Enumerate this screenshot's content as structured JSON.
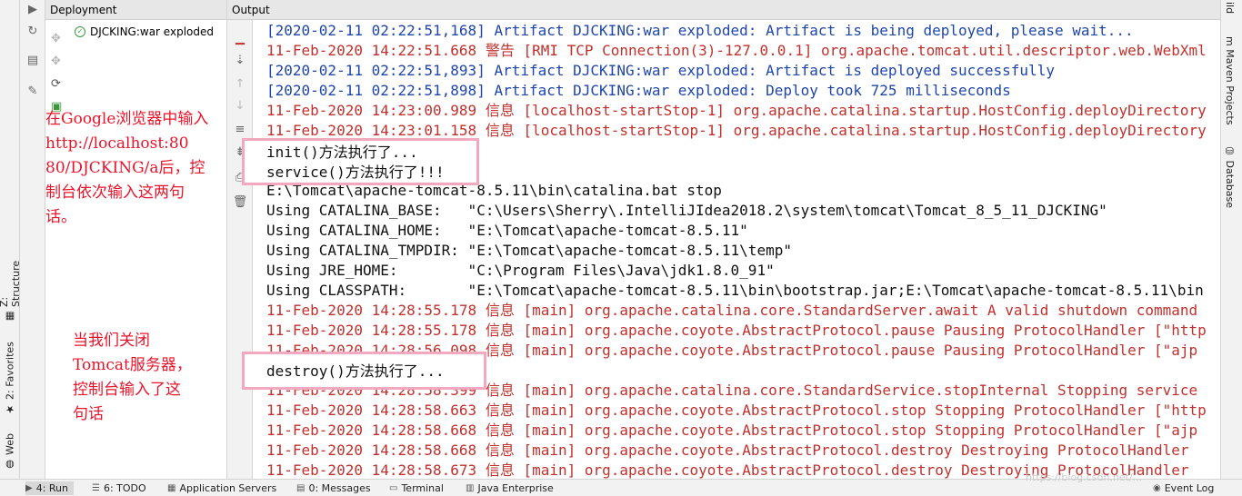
{
  "deployment": {
    "header": "Deployment",
    "item": "DJCKING:war exploded"
  },
  "output": {
    "header": "Output",
    "lines": [
      {
        "c": "blue",
        "t": "[2020-02-11 02:22:51,168] Artifact DJCKING:war exploded: Artifact is being deployed, please wait..."
      },
      {
        "c": "red",
        "t": "11-Feb-2020 14:22:51.668 警告 [RMI TCP Connection(3)-127.0.0.1] org.apache.tomcat.util.descriptor.web.WebXml"
      },
      {
        "c": "blue",
        "t": "[2020-02-11 02:22:51,893] Artifact DJCKING:war exploded: Artifact is deployed successfully"
      },
      {
        "c": "blue",
        "t": "[2020-02-11 02:22:51,898] Artifact DJCKING:war exploded: Deploy took 725 milliseconds"
      },
      {
        "c": "red",
        "t": "11-Feb-2020 14:23:00.989 信息 [localhost-startStop-1] org.apache.catalina.startup.HostConfig.deployDirectory"
      },
      {
        "c": "red",
        "t": "11-Feb-2020 14:23:01.158 信息 [localhost-startStop-1] org.apache.catalina.startup.HostConfig.deployDirectory"
      },
      {
        "c": "black",
        "t": "init()方法执行了..."
      },
      {
        "c": "black",
        "t": "service()方法执行了!!!"
      },
      {
        "c": "black",
        "t": "E:\\Tomcat\\apache-tomcat-8.5.11\\bin\\catalina.bat stop"
      },
      {
        "c": "black",
        "t": "Using CATALINA_BASE:   \"C:\\Users\\Sherry\\.IntelliJIdea2018.2\\system\\tomcat\\Tomcat_8_5_11_DJCKING\""
      },
      {
        "c": "black",
        "t": "Using CATALINA_HOME:   \"E:\\Tomcat\\apache-tomcat-8.5.11\""
      },
      {
        "c": "black",
        "t": "Using CATALINA_TMPDIR: \"E:\\Tomcat\\apache-tomcat-8.5.11\\temp\""
      },
      {
        "c": "black",
        "t": "Using JRE_HOME:        \"C:\\Program Files\\Java\\jdk1.8.0_91\""
      },
      {
        "c": "black",
        "t": "Using CLASSPATH:       \"E:\\Tomcat\\apache-tomcat-8.5.11\\bin\\bootstrap.jar;E:\\Tomcat\\apache-tomcat-8.5.11\\bin"
      },
      {
        "c": "red",
        "t": "11-Feb-2020 14:28:55.178 信息 [main] org.apache.catalina.core.StandardServer.await A valid shutdown command"
      },
      {
        "c": "red",
        "t": "11-Feb-2020 14:28:55.178 信息 [main] org.apache.coyote.AbstractProtocol.pause Pausing ProtocolHandler [\"http"
      },
      {
        "c": "red",
        "t": "11-Feb-2020 14:28:56.098 信息 [main] org.apache.coyote.AbstractProtocol.pause Pausing ProtocolHandler [\"ajp"
      },
      {
        "c": "black",
        "t": "destroy()方法执行了..."
      },
      {
        "c": "red",
        "t": "11-Feb-2020 14:28:58.399 信息 [main] org.apache.catalina.core.StandardService.stopInternal Stopping service"
      },
      {
        "c": "red",
        "t": "11-Feb-2020 14:28:58.663 信息 [main] org.apache.coyote.AbstractProtocol.stop Stopping ProtocolHandler [\"http"
      },
      {
        "c": "red",
        "t": "11-Feb-2020 14:28:58.668 信息 [main] org.apache.coyote.AbstractProtocol.stop Stopping ProtocolHandler [\"ajp"
      },
      {
        "c": "red",
        "t": "11-Feb-2020 14:28:58.668 信息 [main] org.apache.coyote.AbstractProtocol.destroy Destroying ProtocolHandler"
      },
      {
        "c": "red",
        "t": "11-Feb-2020 14:28:58.673 信息 [main] org.apache.coyote.AbstractProtocol.destroy Destroying ProtocolHandler"
      }
    ]
  },
  "highlight_boxes": {
    "box1": [
      "init()方法执行了...",
      "service()方法执行了!!!"
    ],
    "box2": [
      "destroy()方法执行了..."
    ]
  },
  "annotations": {
    "note1": [
      "在Google浏览器中输入",
      "http://localhost:80",
      "80/DJCKING/a后，控",
      "制台依次输入这两句",
      "话。"
    ],
    "note2": [
      "当我们关闭",
      "Tomcat服务器，",
      "控制台输入了这",
      "句话"
    ],
    "color": "#e8142a",
    "box_color": "#f2a9c0"
  },
  "left_strip": {
    "structure": "Z: Structure",
    "favorites": "2: Favorites",
    "web": "Web"
  },
  "right_strip": {
    "build": "ild",
    "maven": "Maven Projects",
    "database": "Database"
  },
  "bottom_bar": {
    "run": "4: Run",
    "todo": "6: TODO",
    "app_servers": "Application Servers",
    "messages": "0: Messages",
    "terminal": "Terminal",
    "java_enterprise": "Java Enterprise",
    "event_log": "Event Log"
  },
  "watermark": "https://blog.csdn.net/..."
}
